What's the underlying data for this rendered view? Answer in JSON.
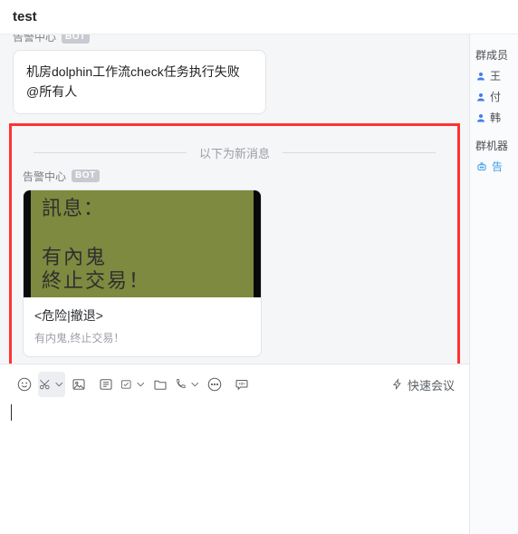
{
  "window": {
    "title": "test"
  },
  "chat": {
    "sender1_name": "告警中心",
    "bot_badge": "BOT",
    "msg1_line1": "机房dolphin工作流check任务执行失败",
    "msg1_line2": "@所有人",
    "divider_label": "以下为新消息",
    "sender2_name": "告警中心",
    "card_img_line1": "訊息：",
    "card_img_line2": "有內鬼",
    "card_img_line3": "終止交易！",
    "card_title": "<危险|撤退>",
    "card_desc": "有内鬼,终止交易！"
  },
  "sidebar": {
    "members_heading": "群成员",
    "members": [
      {
        "name": "王",
        "color": "#3f7fe8"
      },
      {
        "name": "付",
        "color": "#3f7fe8"
      },
      {
        "name": "韩",
        "color": "#3f7fe8"
      }
    ],
    "bots_heading": "群机器",
    "bot_name": "告"
  },
  "composer": {
    "quick_meeting_label": "快速会议"
  }
}
